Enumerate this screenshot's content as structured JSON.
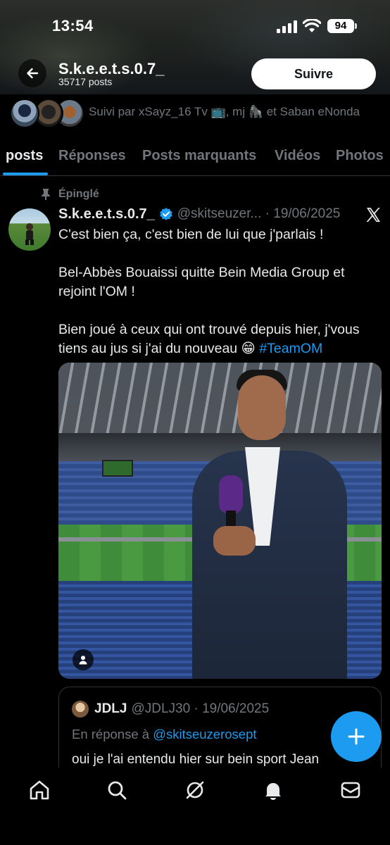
{
  "status_bar": {
    "time": "13:54",
    "battery": "94"
  },
  "profile": {
    "name": "S.k.e.e.t.s.0.7_",
    "post_count": "35717 posts",
    "follow_label": "Suivre",
    "followed_by": "Suivi par xSayz_16 Tv 📺, mj 🦍 et Saban eNonda"
  },
  "tabs": [
    {
      "label": "posts",
      "active": true
    },
    {
      "label": "Réponses",
      "active": false
    },
    {
      "label": "Posts marquants",
      "active": false
    },
    {
      "label": "Vidéos",
      "active": false
    },
    {
      "label": "Photos",
      "active": false
    }
  ],
  "post": {
    "pinned_label": "Épinglé",
    "author_name": "S.k.e.e.t.s.0.7_",
    "handle_date": "@skitseuzer... · 19/06/2025",
    "text_lines": [
      "C'est bien ça, c'est bien de lui que j'parlais !",
      "",
      "Bel-Abbès Bouaissi quitte Bein Media Group et",
      "rejoint l'OM !",
      "",
      "Bien joué à ceux qui ont trouvé depuis hier, j'vous",
      "tiens au jus si j'ai du nouveau 😁"
    ],
    "hashtag": "#TeamOM"
  },
  "reply": {
    "name": "JDLJ",
    "handle_date": "@JDLJ30 · 19/06/2025",
    "reply_to_prefix": "En réponse à",
    "reply_to_mention": "@skitseuzerosept",
    "text": "oui je l'ai entendu hier sur bein sport Jean"
  },
  "colors": {
    "accent": "#1d9bf0",
    "background": "#000000",
    "muted_text": "#71767b",
    "primary_text": "#e7e9ea"
  },
  "icons": {
    "back": "arrow-left-icon",
    "pin": "pin-icon",
    "verified": "verified-badge-icon",
    "x": "x-logo-icon",
    "compose": "plus-icon",
    "nav": [
      "home-icon",
      "search-icon",
      "grok-icon",
      "notifications-icon",
      "messages-icon"
    ]
  }
}
